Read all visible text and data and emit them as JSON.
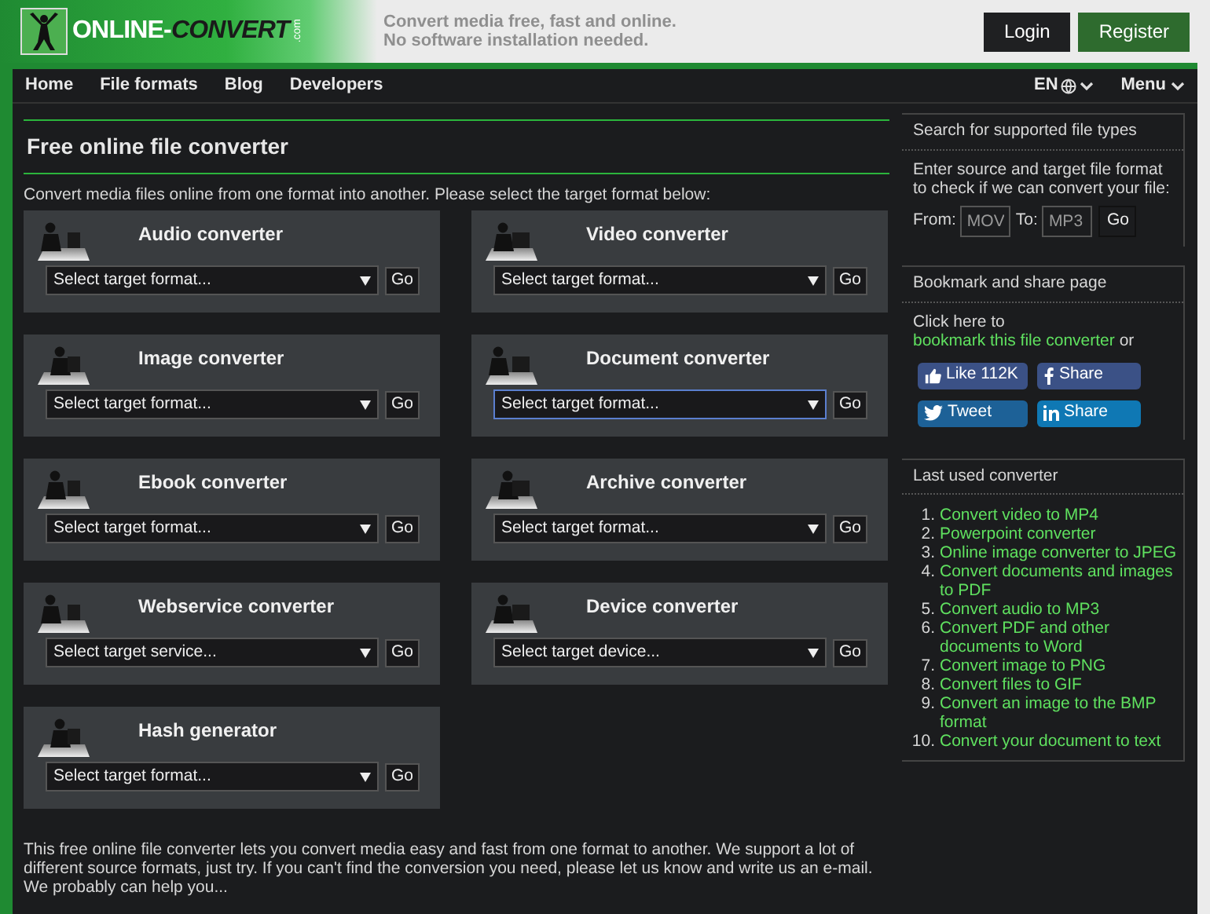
{
  "header": {
    "logo": {
      "part_1": "ONLINE-",
      "part_2": "CONVERT",
      "suffix": ".com"
    },
    "tagline": [
      "Convert media free, fast and online.",
      "No software installation needed."
    ],
    "buttons": [
      {
        "label": "Login",
        "kind": "dark"
      },
      {
        "label": "Register",
        "kind": "green"
      }
    ]
  },
  "nav": {
    "items": [
      "Home",
      "File formats",
      "Blog",
      "Developers"
    ],
    "language": "EN",
    "menu": "Menu"
  },
  "main": {
    "title": "Free online file converter",
    "intro": "Convert media files online from one format into another. Please select the target format below:",
    "converters": [
      {
        "title": "Audio converter",
        "placeholder": "Select target format...",
        "button": "Go",
        "focused": false
      },
      {
        "title": "Video converter",
        "placeholder": "Select target format...",
        "button": "Go",
        "focused": false
      },
      {
        "title": "Image converter",
        "placeholder": "Select target format...",
        "button": "Go",
        "focused": false
      },
      {
        "title": "Document converter",
        "placeholder": "Select target format...",
        "button": "Go",
        "focused": true
      },
      {
        "title": "Ebook converter",
        "placeholder": "Select target format...",
        "button": "Go",
        "focused": false
      },
      {
        "title": "Archive converter",
        "placeholder": "Select target format...",
        "button": "Go",
        "focused": false
      },
      {
        "title": "Webservice converter",
        "placeholder": "Select target service...",
        "button": "Go",
        "focused": false
      },
      {
        "title": "Device converter",
        "placeholder": "Select target device...",
        "button": "Go",
        "focused": false
      },
      {
        "title": "Hash generator",
        "placeholder": "Select target format...",
        "button": "Go",
        "focused": false
      }
    ],
    "footer_text": "This free online file converter lets you convert media easy and fast from one format to another. We support a lot of different source formats, just try. If you can't find the conversion you need, please let us know and write us an e-mail. We probably can help you..."
  },
  "sidebar": {
    "search": {
      "title": "Search for supported file types",
      "text": "Enter source and target file format to check if we can convert your file:",
      "from_label": "From:",
      "from_placeholder": "MOV",
      "to_label": "To:",
      "to_placeholder": "MP3",
      "button": "Go"
    },
    "share": {
      "title": "Bookmark and share page",
      "text_before": "Click here to",
      "link": "bookmark this file converter",
      "text_after": "or",
      "buttons": [
        {
          "label": "Like 112K",
          "kind": "like"
        },
        {
          "label": "Share",
          "kind": "facebook"
        },
        {
          "label": "Tweet",
          "kind": "twitter"
        },
        {
          "label": "Share",
          "kind": "linkedin"
        }
      ]
    },
    "last_used": {
      "title": "Last used converter",
      "items": [
        {
          "number": "1.",
          "label": "Convert video to MP4"
        },
        {
          "number": "2.",
          "label": "Powerpoint converter"
        },
        {
          "number": "3.",
          "label": "Online image converter to JPEG"
        },
        {
          "number": "4.",
          "label": "Convert documents and images to PDF"
        },
        {
          "number": "5.",
          "label": "Convert audio to MP3"
        },
        {
          "number": "6.",
          "label": "Convert PDF and other documents to Word"
        },
        {
          "number": "7.",
          "label": "Convert image to PNG"
        },
        {
          "number": "8.",
          "label": "Convert files to GIF"
        },
        {
          "number": "9.",
          "label": "Convert an image to the BMP format"
        },
        {
          "number": "10.",
          "label": "Convert your document to text"
        }
      ]
    }
  }
}
